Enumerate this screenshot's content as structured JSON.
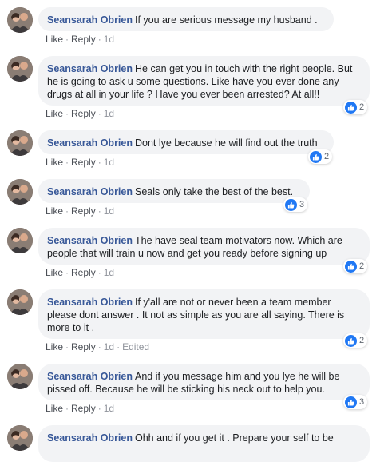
{
  "colors": {
    "author": "#385898",
    "bubble": "#f2f3f5",
    "like_badge": "#2078f4",
    "meta": "#606770"
  },
  "comments": [
    {
      "author": "Seansarah Obrien",
      "text": "If you are serious message my husband .",
      "actions": {
        "like": "Like",
        "reply": "Reply",
        "time": "1d",
        "edited": ""
      },
      "reaction_icon": "like-icon",
      "reaction_count": ""
    },
    {
      "author": "Seansarah Obrien",
      "text": "He can get you in touch with the right people. But he is going to ask u some questions. Like have you ever done any drugs at all in your life ? Have you ever been arrested? At all!!",
      "actions": {
        "like": "Like",
        "reply": "Reply",
        "time": "1d",
        "edited": ""
      },
      "reaction_icon": "like-icon",
      "reaction_count": "2"
    },
    {
      "author": "Seansarah Obrien",
      "text": "Dont lye because he will find out the truth",
      "actions": {
        "like": "Like",
        "reply": "Reply",
        "time": "1d",
        "edited": ""
      },
      "reaction_icon": "like-icon",
      "reaction_count": "2"
    },
    {
      "author": "Seansarah Obrien",
      "text": "Seals only take the best of the best.",
      "actions": {
        "like": "Like",
        "reply": "Reply",
        "time": "1d",
        "edited": ""
      },
      "reaction_icon": "like-icon",
      "reaction_count": "3"
    },
    {
      "author": "Seansarah Obrien",
      "text": "The have seal team motivators now. Which are people that will train u now and get you ready before signing up",
      "actions": {
        "like": "Like",
        "reply": "Reply",
        "time": "1d",
        "edited": ""
      },
      "reaction_icon": "like-icon",
      "reaction_count": "2"
    },
    {
      "author": "Seansarah Obrien",
      "text": "If y'all are not or never been a team member please dont answer . It not as simple as you are all saying. There is more to it .",
      "actions": {
        "like": "Like",
        "reply": "Reply",
        "time": "1d",
        "edited": "Edited"
      },
      "reaction_icon": "like-icon",
      "reaction_count": "2"
    },
    {
      "author": "Seansarah Obrien",
      "text": "And if you message him and you lye he will be pissed off. Because he will be sticking his neck out to help you.",
      "actions": {
        "like": "Like",
        "reply": "Reply",
        "time": "1d",
        "edited": ""
      },
      "reaction_icon": "like-icon",
      "reaction_count": "3"
    },
    {
      "author": "Seansarah Obrien",
      "text": "Ohh and if you get it . Prepare your self to be",
      "actions": {
        "like": "",
        "reply": "",
        "time": "",
        "edited": ""
      },
      "reaction_icon": "",
      "reaction_count": ""
    }
  ]
}
